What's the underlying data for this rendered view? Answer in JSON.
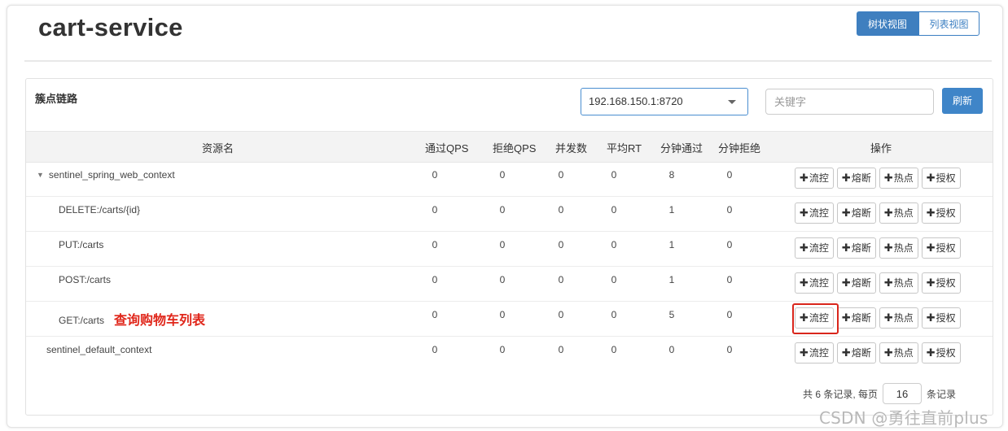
{
  "page": {
    "title": "cart-service",
    "view_tree": "树状视图",
    "view_list": "列表视图"
  },
  "panel": {
    "title": "簇点链路",
    "machine": "192.168.150.1:8720",
    "keyword_placeholder": "关键字",
    "refresh": "刷新"
  },
  "table": {
    "headers": {
      "resource": "资源名",
      "pass_qps": "通过QPS",
      "block_qps": "拒绝QPS",
      "concurrency": "并发数",
      "avg_rt": "平均RT",
      "min_pass": "分钟通过",
      "min_block": "分钟拒绝",
      "ops": "操作"
    },
    "rows": [
      {
        "name": "sentinel_spring_web_context",
        "arrow": "▼",
        "pass_qps": "0",
        "block_qps": "0",
        "concurrency": "0",
        "avg_rt": "0",
        "min_pass": "8",
        "min_block": "0"
      },
      {
        "name": "DELETE:/carts/{id}",
        "pass_qps": "0",
        "block_qps": "0",
        "concurrency": "0",
        "avg_rt": "0",
        "min_pass": "1",
        "min_block": "0"
      },
      {
        "name": "PUT:/carts",
        "pass_qps": "0",
        "block_qps": "0",
        "concurrency": "0",
        "avg_rt": "0",
        "min_pass": "1",
        "min_block": "0"
      },
      {
        "name": "POST:/carts",
        "pass_qps": "0",
        "block_qps": "0",
        "concurrency": "0",
        "avg_rt": "0",
        "min_pass": "1",
        "min_block": "0"
      },
      {
        "name": "GET:/carts",
        "annotation": "查询购物车列表",
        "pass_qps": "0",
        "block_qps": "0",
        "concurrency": "0",
        "avg_rt": "0",
        "min_pass": "5",
        "min_block": "0"
      },
      {
        "name": "sentinel_default_context",
        "pass_qps": "0",
        "block_qps": "0",
        "concurrency": "0",
        "avg_rt": "0",
        "min_pass": "0",
        "min_block": "0"
      }
    ],
    "op_plus": "✚",
    "op_labels": {
      "flow": "流控",
      "degrade": "熔断",
      "hotspot": "热点",
      "authority": "授权"
    }
  },
  "pager": {
    "prefix": "共 6 条记录, 每页",
    "page_size": "16",
    "suffix": "条记录"
  },
  "watermark": "CSDN @勇往直前plus",
  "colors": {
    "primary": "#3f85c8",
    "highlight": "#d9261c",
    "annotation": "#e0261a"
  }
}
